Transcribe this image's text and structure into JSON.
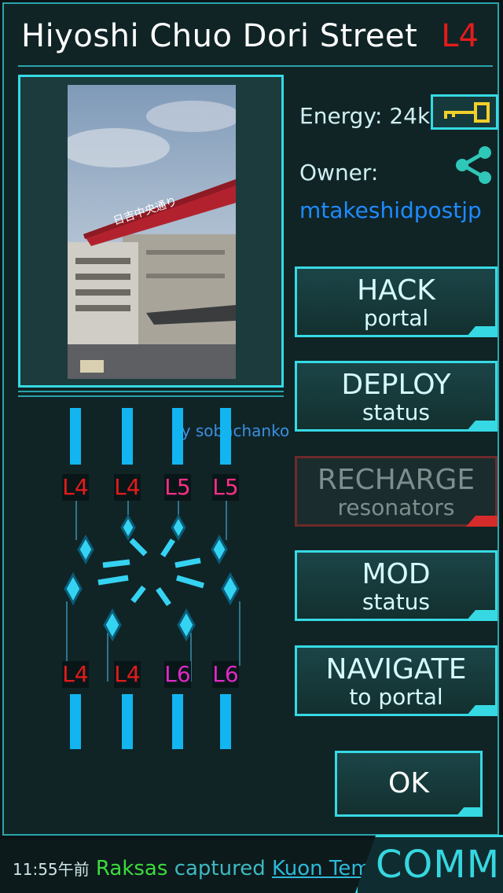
{
  "portal": {
    "title": "Hiyoshi Chuo Dori Street",
    "level": "L4",
    "photo_credit": "by sobachanko",
    "photo_sign_text": "日吉中央通り",
    "energy_label": "Energy: 24k",
    "owner_label": "Owner:",
    "owner_name": "mtakeshidpostjp"
  },
  "actions": [
    {
      "main": "HACK",
      "sub": "portal",
      "enabled": true
    },
    {
      "main": "DEPLOY",
      "sub": "status",
      "enabled": true
    },
    {
      "main": "RECHARGE",
      "sub": "resonators",
      "enabled": false
    },
    {
      "main": "MOD",
      "sub": "status",
      "enabled": true
    },
    {
      "main": "NAVIGATE",
      "sub": "to portal",
      "enabled": true
    }
  ],
  "ok_label": "OK",
  "resonators": {
    "top": [
      {
        "level": "L4",
        "color": "#e51b1b"
      },
      {
        "level": "L4",
        "color": "#e51b1b"
      },
      {
        "level": "L5",
        "color": "#ff2f86"
      },
      {
        "level": "L5",
        "color": "#ff2f86"
      }
    ],
    "bottom": [
      {
        "level": "L4",
        "color": "#e51b1b"
      },
      {
        "level": "L4",
        "color": "#e51b1b"
      },
      {
        "level": "L6",
        "color": "#e029c8"
      },
      {
        "level": "L6",
        "color": "#e029c8"
      }
    ]
  },
  "status_bar": {
    "time": "11:55午前",
    "agent": "Raksas",
    "action": "captured",
    "portal": "Kuon Tem..."
  },
  "comm_label": "COMM",
  "icons": {
    "key": "key-icon",
    "share": "share-icon",
    "mod_slot": "mod-slot-icon"
  }
}
